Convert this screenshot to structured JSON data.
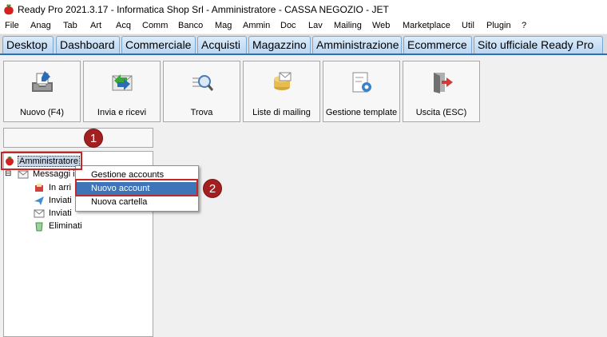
{
  "window": {
    "title": "Ready Pro 2021.3.17 - Informatica Shop Srl - Amministratore - CASSA NEGOZIO - JET"
  },
  "menu": [
    "File",
    "Anag",
    "Tab",
    "Art",
    "Acq",
    "Comm",
    "Banco",
    "Mag",
    "Ammin",
    "Doc",
    "Lav",
    "Mailing",
    "Web",
    "Marketplace",
    "Util",
    "Plugin",
    "?"
  ],
  "tabs": [
    "Desktop",
    "Dashboard",
    "Commerciale",
    "Acquisti",
    "Magazzino",
    "Amministrazione",
    "Ecommerce",
    "Sito ufficiale Ready Pro"
  ],
  "toolbar": [
    {
      "label": "Nuovo (F4)",
      "icon": "new-mail-icon"
    },
    {
      "label": "Invia e ricevi",
      "icon": "send-receive-icon"
    },
    {
      "label": "Trova",
      "icon": "find-icon"
    },
    {
      "label": "Liste di mailing",
      "icon": "mailing-list-icon"
    },
    {
      "label": "Gestione template",
      "icon": "template-settings-icon"
    },
    {
      "label": "Uscita (ESC)",
      "icon": "exit-icon"
    }
  ],
  "tree": {
    "root": "Amministratore",
    "folder": "Messaggi in",
    "children": [
      "In arri",
      "Inviati",
      "Inviati",
      "Eliminati"
    ]
  },
  "context_menu": {
    "items": [
      "Gestione accounts",
      "Nuovo account",
      "Nuova cartella"
    ],
    "selected_index": 1
  },
  "callouts": [
    "1",
    "2"
  ],
  "colors": {
    "accent": "#2f6fb5",
    "selection": "#3e74b8",
    "highlight": "#c0282a",
    "badge": "#a32020"
  }
}
